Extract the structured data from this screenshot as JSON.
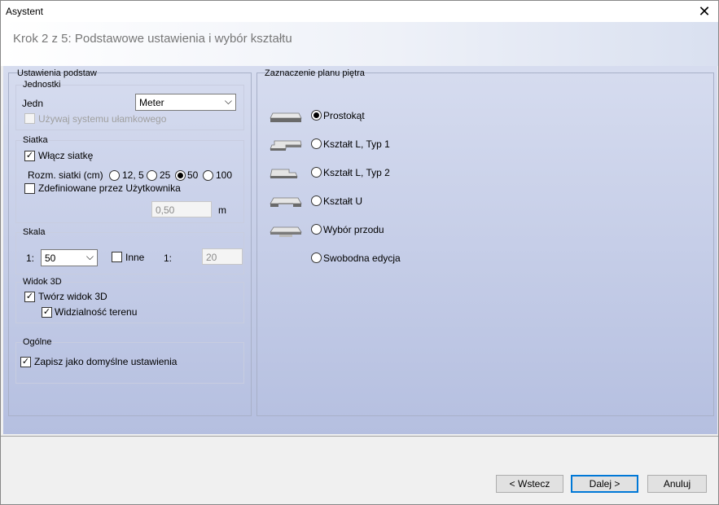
{
  "window": {
    "title": "Asystent"
  },
  "header": {
    "step": "Krok 2 z 5:  Podstawowe ustawienia i wybór kształtu"
  },
  "left": {
    "legend": "Ustawienia podstaw",
    "units": {
      "label": "Jednostki",
      "jedn_label": "Jedn",
      "unit_value": "Meter",
      "fraction_label": "Używaj systemu ułamkowego"
    },
    "grid": {
      "label": "Siatka",
      "enable_label": "Włącz siatkę",
      "size_label": "Rozm. siatki (cm)",
      "options": [
        "12, 5",
        "25",
        "50",
        "100"
      ],
      "selected": "50",
      "custom_label": "Zdefiniowane przez Użytkownika",
      "custom_value": "0,50",
      "custom_unit": "m"
    },
    "scale": {
      "label": "Skala",
      "prefix": "1:",
      "value": "50",
      "other_label": "Inne",
      "other_prefix": "1:",
      "other_value": "20"
    },
    "view3d": {
      "label": "Widok 3D",
      "create_label": "Twórz widok 3D",
      "terrain_label": "Widzialność terenu"
    },
    "general": {
      "label": "Ogólne",
      "save_label": "Zapisz jako domyślne ustawienia"
    }
  },
  "right": {
    "legend": "Zaznaczenie planu piętra",
    "shapes": [
      {
        "label": "Prostokąt",
        "icon": "rectangle-plan-icon",
        "selected": true
      },
      {
        "label": "Kształt L, Typ 1",
        "icon": "l-shape-type1-icon",
        "selected": false
      },
      {
        "label": "Kształt L, Typ 2",
        "icon": "l-shape-type2-icon",
        "selected": false
      },
      {
        "label": "Kształt U",
        "icon": "u-shape-icon",
        "selected": false
      },
      {
        "label": "Wybór przodu",
        "icon": "front-selection-icon",
        "selected": false
      },
      {
        "label": "Swobodna edycja",
        "icon": "",
        "selected": false
      }
    ]
  },
  "footer": {
    "back": "< Wstecz",
    "next": "Dalej >",
    "cancel": "Anuluj"
  }
}
